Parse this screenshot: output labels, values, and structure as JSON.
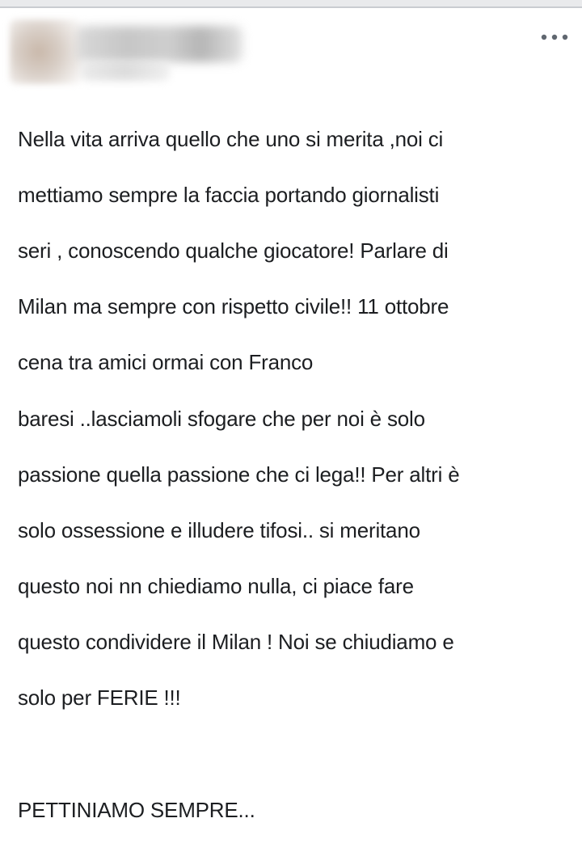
{
  "post": {
    "more_icon": "more-horizontal-icon",
    "lines": [
      "Nella vita arriva quello che uno si merita ,noi ci",
      "mettiamo sempre la faccia portando giornalisti",
      "seri , conoscendo qualche giocatore! Parlare di",
      "Milan ma sempre con rispetto civile!! 11 ottobre",
      "cena tra amici ormai con Franco",
      "baresi ..lasciamoli sfogare che per noi è solo",
      "passione quella passione che ci lega!! Per altri è",
      "solo ossessione e illudere tifosi.. si meritano",
      "questo noi nn chiediamo nulla, ci piace fare",
      "questo condividere il Milan ! Noi se chiudiamo e",
      "solo per FERIE !!!"
    ],
    "closing": "PETTINIAMO SEMPRE..."
  },
  "colors": {
    "text": "#1c1e21",
    "icon": "#606770",
    "divider": "#c9ccd1"
  }
}
